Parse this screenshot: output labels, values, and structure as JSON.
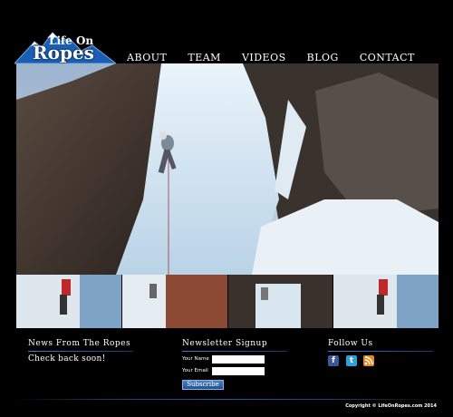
{
  "logo": {
    "top": "Life On",
    "main": "Ropes"
  },
  "nav": [
    "ABOUT",
    "TEAM",
    "VIDEOS",
    "BLOG",
    "CONTACT"
  ],
  "news": {
    "title": "News From The Ropes",
    "text": "Check back soon!"
  },
  "newsletter": {
    "title": "Newsletter Signup",
    "name_label": "Your Name",
    "email_label": "Your Email",
    "button": "Subscribe"
  },
  "follow": {
    "title": "Follow Us",
    "icons": [
      "facebook-icon",
      "twitter-icon",
      "rss-icon"
    ]
  },
  "colors": {
    "facebook": "#3b5998",
    "twitter": "#2e9fd8",
    "rss": "#e8861e",
    "accent": "#2c5a9a"
  },
  "copyright": "Copyright © LifeOnRopes.com 2014"
}
